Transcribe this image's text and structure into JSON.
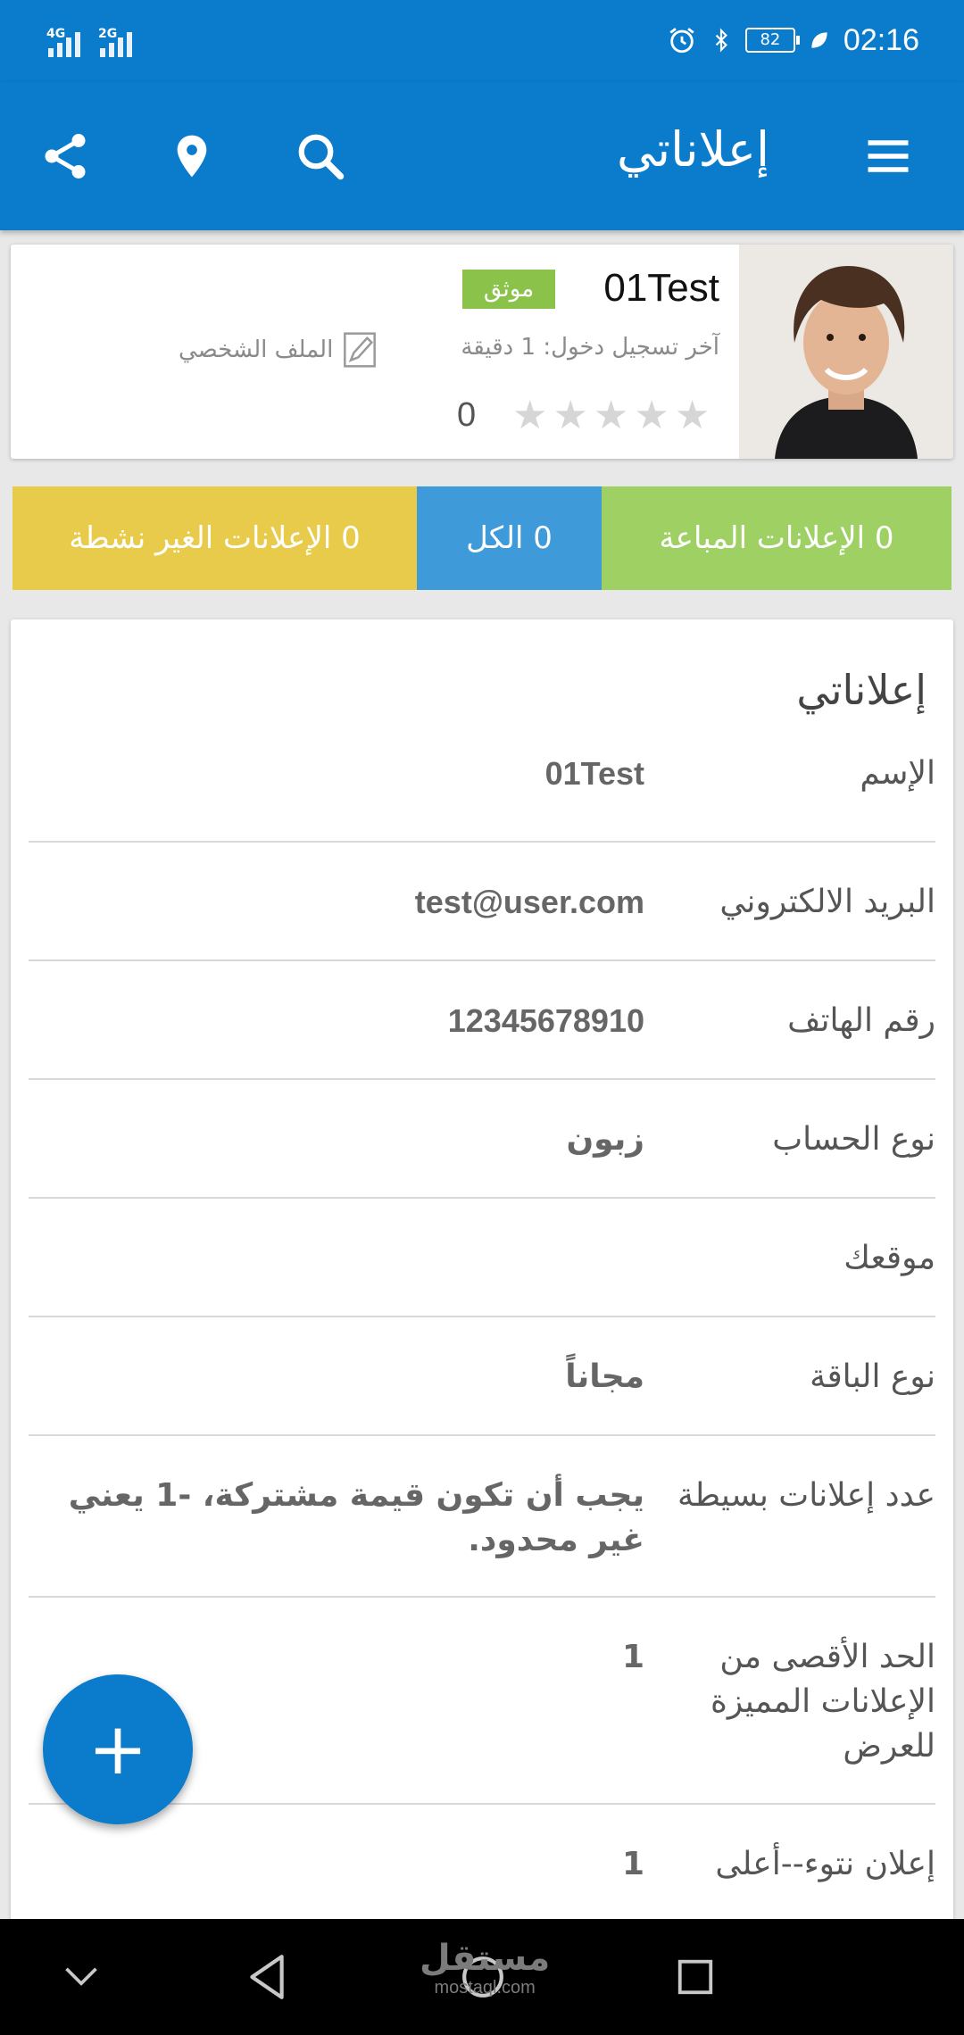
{
  "status_bar": {
    "network_1": "4G",
    "network_2": "2G",
    "battery": "82",
    "time": "02:16"
  },
  "app_bar": {
    "title": "إعلاناتي",
    "icons": [
      "menu-icon",
      "search-icon",
      "location-pin-icon",
      "share-icon"
    ]
  },
  "profile": {
    "name": "01Test",
    "verified_badge": "موثق",
    "last_login": "آخر تسجيل دخول: 1 دقيقة",
    "profile_link": "الملف الشخصي",
    "rating_value": "0",
    "stars_total": 5
  },
  "stats": {
    "sold": "0 الإعلانات المباعة",
    "all": "0 الكل",
    "inactive": "0 الإعلانات الغير نشطة",
    "colors": {
      "sold": "#9ed064",
      "all": "#3e9ad8",
      "inactive": "#e8cb4a"
    }
  },
  "details": {
    "title": "إعلاناتي",
    "rows": [
      {
        "label": "الإسم",
        "value": "01Test"
      },
      {
        "label": "البريد الالكتروني",
        "value": "test@user.com"
      },
      {
        "label": "رقم الهاتف",
        "value": "12345678910"
      },
      {
        "label": "نوع الحساب",
        "value": "زبون"
      },
      {
        "label": "موقعك",
        "value": ""
      },
      {
        "label": "نوع الباقة",
        "value": "مجاناً"
      },
      {
        "label": "عدد إعلانات بسيطة",
        "value": "يجب أن تكون قيمة مشتركة، -1 يعني غير محدود."
      },
      {
        "label": "الحد الأقصى من الإعلانات المميزة للعرض",
        "value": "1"
      },
      {
        "label": "إعلان نتوء--أعلى",
        "value": "1"
      }
    ]
  },
  "fab": {
    "label": "+"
  },
  "watermark": {
    "line1": "مستقل",
    "line2": "mostaql.com"
  },
  "theme": {
    "primary": "#0b7bcb"
  }
}
